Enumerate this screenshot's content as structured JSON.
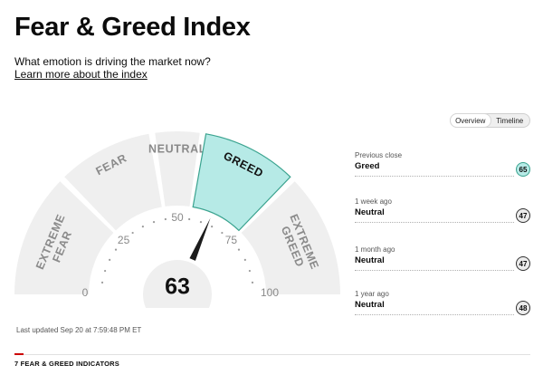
{
  "header": {
    "title": "Fear & Greed Index",
    "subtitle": "What emotion is driving the market now?",
    "learn_more": "Learn more about the index"
  },
  "toggle": {
    "options": [
      "Overview",
      "Timeline"
    ],
    "active": "Overview"
  },
  "gauge": {
    "value": 63,
    "min": 0,
    "max": 100,
    "segments": [
      {
        "label": "EXTREME FEAR",
        "from": 0,
        "to": 25,
        "active": false
      },
      {
        "label": "FEAR",
        "from": 25,
        "to": 45,
        "active": false
      },
      {
        "label": "NEUTRAL",
        "from": 45,
        "to": 55,
        "active": false
      },
      {
        "label": "GREED",
        "from": 55,
        "to": 75,
        "active": true
      },
      {
        "label": "EXTREME GREED",
        "from": 75,
        "to": 100,
        "active": false
      }
    ],
    "scale_labels": [
      "0",
      "25",
      "50",
      "75",
      "100"
    ],
    "colors": {
      "segment": "#efefef",
      "active_fill": "#b6eae6",
      "active_stroke": "#3aa38f",
      "label": "#8a8a8a",
      "needle": "#1c1c1c"
    }
  },
  "history": [
    {
      "label": "Previous close",
      "rating": "Greed",
      "value": 65,
      "highlight": true
    },
    {
      "label": "1 week ago",
      "rating": "Neutral",
      "value": 47,
      "highlight": false
    },
    {
      "label": "1 month ago",
      "rating": "Neutral",
      "value": 47,
      "highlight": false
    },
    {
      "label": "1 year ago",
      "rating": "Neutral",
      "value": 48,
      "highlight": false
    }
  ],
  "last_updated": "Last updated Sep 20 at 7:59:48 PM ET",
  "indicators_title": "7 FEAR & GREED INDICATORS",
  "colors": {
    "greed_badge_bg": "#b6eae6",
    "greed_badge_border": "#3aa38f",
    "accent_red": "#cc0000"
  }
}
